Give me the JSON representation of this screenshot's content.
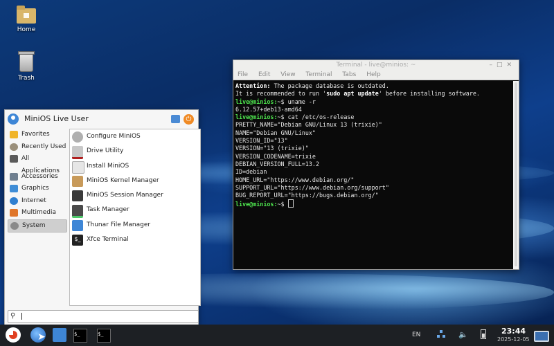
{
  "desktop": {
    "icons": [
      {
        "label": "Home",
        "icon": "home-folder-icon"
      },
      {
        "label": "Trash",
        "icon": "trash-icon"
      }
    ]
  },
  "terminal": {
    "title": "Terminal - live@minios: ~",
    "menu": [
      "File",
      "Edit",
      "View",
      "Terminal",
      "Tabs",
      "Help"
    ],
    "lines": [
      {
        "segments": [
          {
            "text": "Attention:",
            "style": "b"
          },
          {
            "text": " The package database is outdated.",
            "style": ""
          }
        ]
      },
      {
        "segments": [
          {
            "text": "It is recommended to run '",
            "style": ""
          },
          {
            "text": "sudo apt update",
            "style": "b"
          },
          {
            "text": "' before installing software.",
            "style": ""
          }
        ]
      },
      {
        "segments": [
          {
            "text": "live@minios:",
            "style": "g"
          },
          {
            "text": "~$ uname -r",
            "style": ""
          }
        ]
      },
      {
        "segments": [
          {
            "text": "6.12.57+deb13-amd64",
            "style": ""
          }
        ]
      },
      {
        "segments": [
          {
            "text": "live@minios:",
            "style": "g"
          },
          {
            "text": "~$ cat /etc/os-release",
            "style": ""
          }
        ]
      },
      {
        "segments": [
          {
            "text": "PRETTY_NAME=\"Debian GNU/Linux 13 (trixie)\"",
            "style": ""
          }
        ]
      },
      {
        "segments": [
          {
            "text": "NAME=\"Debian GNU/Linux\"",
            "style": ""
          }
        ]
      },
      {
        "segments": [
          {
            "text": "VERSION_ID=\"13\"",
            "style": ""
          }
        ]
      },
      {
        "segments": [
          {
            "text": "VERSION=\"13 (trixie)\"",
            "style": ""
          }
        ]
      },
      {
        "segments": [
          {
            "text": "VERSION_CODENAME=trixie",
            "style": ""
          }
        ]
      },
      {
        "segments": [
          {
            "text": "DEBIAN_VERSION_FULL=13.2",
            "style": ""
          }
        ]
      },
      {
        "segments": [
          {
            "text": "ID=debian",
            "style": ""
          }
        ]
      },
      {
        "segments": [
          {
            "text": "HOME_URL=\"https://www.debian.org/\"",
            "style": ""
          }
        ]
      },
      {
        "segments": [
          {
            "text": "SUPPORT_URL=\"https://www.debian.org/support\"",
            "style": ""
          }
        ]
      },
      {
        "segments": [
          {
            "text": "BUG_REPORT_URL=\"https://bugs.debian.org/\"",
            "style": ""
          }
        ]
      },
      {
        "segments": [
          {
            "text": "live@minios:",
            "style": "g"
          },
          {
            "text": "~$ ",
            "style": ""
          }
        ],
        "cursor": true
      }
    ]
  },
  "menu": {
    "user": "MiniOS Live User",
    "categories": [
      {
        "label": "Favorites",
        "icon": "star-icon",
        "color": "#f0b429"
      },
      {
        "label": "Recently Used",
        "icon": "clock-icon",
        "color": "#9a8f7a"
      },
      {
        "label": "All Applications",
        "icon": "grid-icon",
        "color": "#5a5a5a"
      },
      {
        "label": "Accessories",
        "icon": "accessories-icon",
        "color": "#6f7f8f"
      },
      {
        "label": "Graphics",
        "icon": "graphics-icon",
        "color": "#3f8dd6"
      },
      {
        "label": "Internet",
        "icon": "globe-icon",
        "color": "#2f7fd0"
      },
      {
        "label": "Multimedia",
        "icon": "multimedia-icon",
        "color": "#e0762a"
      },
      {
        "label": "System",
        "icon": "system-gear-icon",
        "color": "#8a8a8a"
      }
    ],
    "selected_category": "System",
    "apps": [
      {
        "label": "Configure MiniOS",
        "icon": "gear-icon",
        "color": "#b0b0b0"
      },
      {
        "label": "Drive Utility",
        "icon": "drive-icon",
        "color": "#c8c8c8"
      },
      {
        "label": "Install MiniOS",
        "icon": "install-icon",
        "color": "#e6e6e6"
      },
      {
        "label": "MiniOS Kernel Manager",
        "icon": "kernel-box-icon",
        "color": "#c89a5a"
      },
      {
        "label": "MiniOS Session Manager",
        "icon": "floppy-icon",
        "color": "#3a3a3a"
      },
      {
        "label": "Task Manager",
        "icon": "task-manager-icon",
        "color": "#4a4a4a"
      },
      {
        "label": "Thunar File Manager",
        "icon": "home-folder-icon",
        "color": "#3e86d6"
      },
      {
        "label": "Xfce Terminal",
        "icon": "terminal-icon",
        "color": "#222222"
      }
    ],
    "search_placeholder": ""
  },
  "taskbar": {
    "language": "EN",
    "time": "23:44",
    "date": "2025-12-05"
  }
}
